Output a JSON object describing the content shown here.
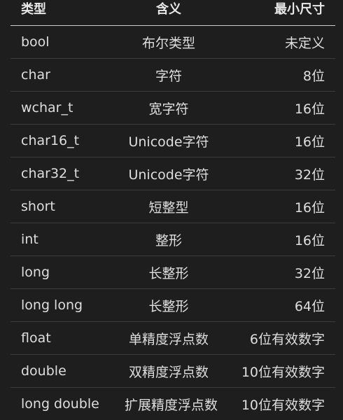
{
  "table": {
    "headers": [
      "类型",
      "含义",
      "最小尺寸"
    ],
    "rows": [
      [
        "bool",
        "布尔类型",
        "未定义"
      ],
      [
        "char",
        "字符",
        "8位"
      ],
      [
        "wchar_t",
        "宽字符",
        "16位"
      ],
      [
        "char16_t",
        "Unicode字符",
        "16位"
      ],
      [
        "char32_t",
        "Unicode字符",
        "32位"
      ],
      [
        "short",
        "短整型",
        "16位"
      ],
      [
        "int",
        "整形",
        "16位"
      ],
      [
        "long",
        "长整形",
        "32位"
      ],
      [
        "long long",
        "长整形",
        "64位"
      ],
      [
        "float",
        "单精度浮点数",
        "6位有效数字"
      ],
      [
        "double",
        "双精度浮点数",
        "10位有效数字"
      ],
      [
        "long double",
        "扩展精度浮点数",
        "10位有效数字"
      ]
    ]
  }
}
